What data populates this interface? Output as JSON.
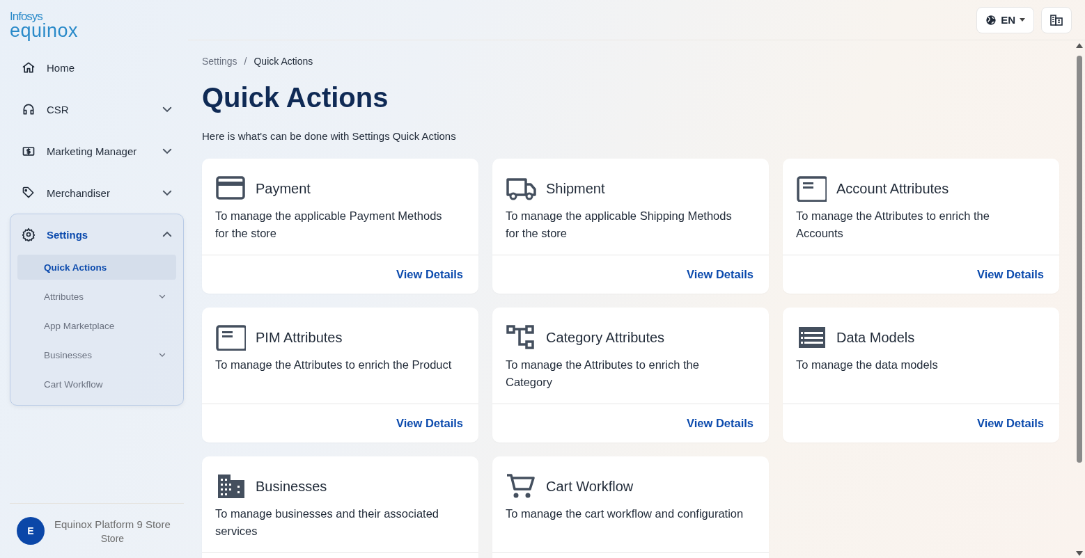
{
  "logo": {
    "brand": "Infosys",
    "product": "equinox"
  },
  "header": {
    "language": "EN"
  },
  "sidebar": {
    "items": [
      {
        "label": "Home",
        "kind": "link",
        "selected": false
      },
      {
        "label": "CSR",
        "kind": "group",
        "selected": false,
        "expanded": false
      },
      {
        "label": "Marketing Manager",
        "kind": "group",
        "selected": false,
        "expanded": false
      },
      {
        "label": "Merchandiser",
        "kind": "group",
        "selected": false,
        "expanded": false
      },
      {
        "label": "Settings",
        "kind": "group",
        "selected": true,
        "expanded": true,
        "children": [
          {
            "label": "Quick Actions",
            "kind": "link",
            "selected": true
          },
          {
            "label": "Attributes",
            "kind": "group",
            "selected": false,
            "expanded": false
          },
          {
            "label": "App Marketplace",
            "kind": "link",
            "selected": false
          },
          {
            "label": "Businesses",
            "kind": "group",
            "selected": false,
            "expanded": false
          },
          {
            "label": "Cart Workflow",
            "kind": "link",
            "selected": false
          }
        ]
      }
    ]
  },
  "account": {
    "initial": "E",
    "name": "Equinox Platform 9 Store",
    "role": "Store"
  },
  "breadcrumb": {
    "items": [
      "Settings",
      "Quick Actions"
    ],
    "separator": "/"
  },
  "title": "Quick Actions",
  "subtitle": "Here is what's can be done with Settings Quick Actions",
  "cards": [
    {
      "title": "Payment",
      "description": "To manage the applicable Payment Methods for the store",
      "link": "View Details"
    },
    {
      "title": "Shipment",
      "description": "To manage the applicable Shipping Methods for the store",
      "link": "View Details"
    },
    {
      "title": "Account Attributes",
      "description": "To manage the Attributes to enrich the Accounts",
      "link": "View Details"
    },
    {
      "title": "PIM Attributes",
      "description": "To manage the Attributes to enrich the Product",
      "link": "View Details"
    },
    {
      "title": "Category Attributes",
      "description": "To manage the Attributes to enrich the Category",
      "link": "View Details"
    },
    {
      "title": "Data Models",
      "description": "To manage the data models",
      "link": "View Details"
    },
    {
      "title": "Businesses",
      "description": "To manage businesses and their associated services"
    },
    {
      "title": "Cart Workflow",
      "description": "To manage the cart workflow and configuration"
    }
  ]
}
